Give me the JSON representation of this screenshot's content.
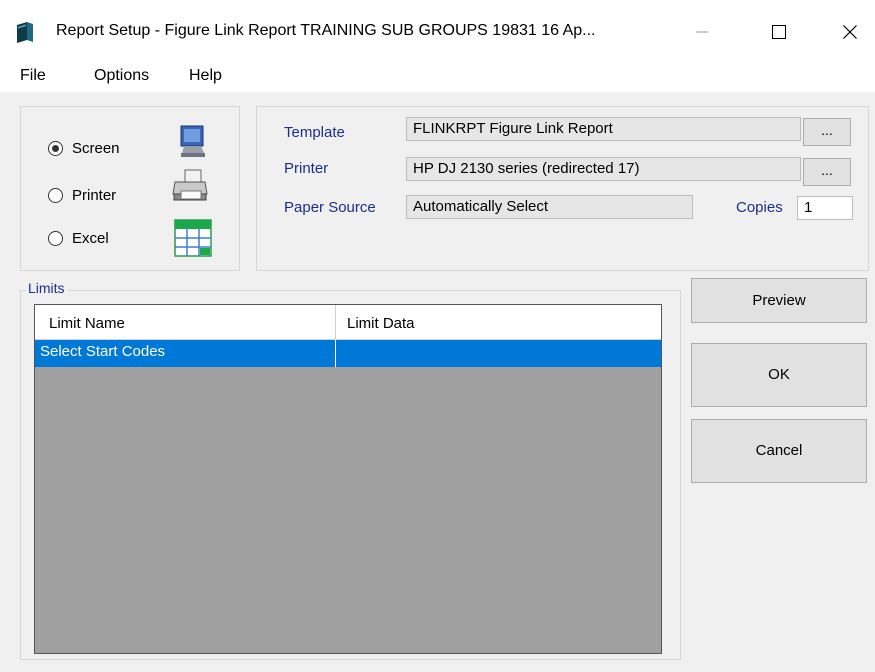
{
  "window": {
    "title": "Report Setup - Figure Link Report TRAINING SUB GROUPS 19831 16 Ap...",
    "controls": [
      "minimize-icon",
      "maximize-icon",
      "close-icon"
    ]
  },
  "menu": {
    "items": [
      "File",
      "Options",
      "Help"
    ]
  },
  "output": {
    "options": [
      {
        "label": "Screen",
        "checked": true,
        "icon": "monitor-icon"
      },
      {
        "label": "Printer",
        "checked": false,
        "icon": "printer-icon"
      },
      {
        "label": "Excel",
        "checked": false,
        "icon": "spreadsheet-icon"
      }
    ]
  },
  "settings": {
    "template_label": "Template",
    "template_value": "FLINKRPT Figure Link Report",
    "printer_label": "Printer",
    "printer_value": "HP DJ 2130 series (redirected 17)",
    "paper_label": "Paper Source",
    "paper_value": "Automatically Select",
    "copies_label": "Copies",
    "copies_value": "1",
    "browse_label": "..."
  },
  "limits": {
    "group_label": "Limits",
    "columns": [
      "Limit Name",
      "Limit Data"
    ],
    "rows": [
      {
        "name": "Select Start Codes",
        "data": "",
        "selected": true
      }
    ]
  },
  "actions": {
    "preview": "Preview",
    "ok": "OK",
    "cancel": "Cancel"
  },
  "colors": {
    "selection": "#0078d7",
    "label_text": "#1a2f8a",
    "grid_background": "#a0a0a0"
  }
}
